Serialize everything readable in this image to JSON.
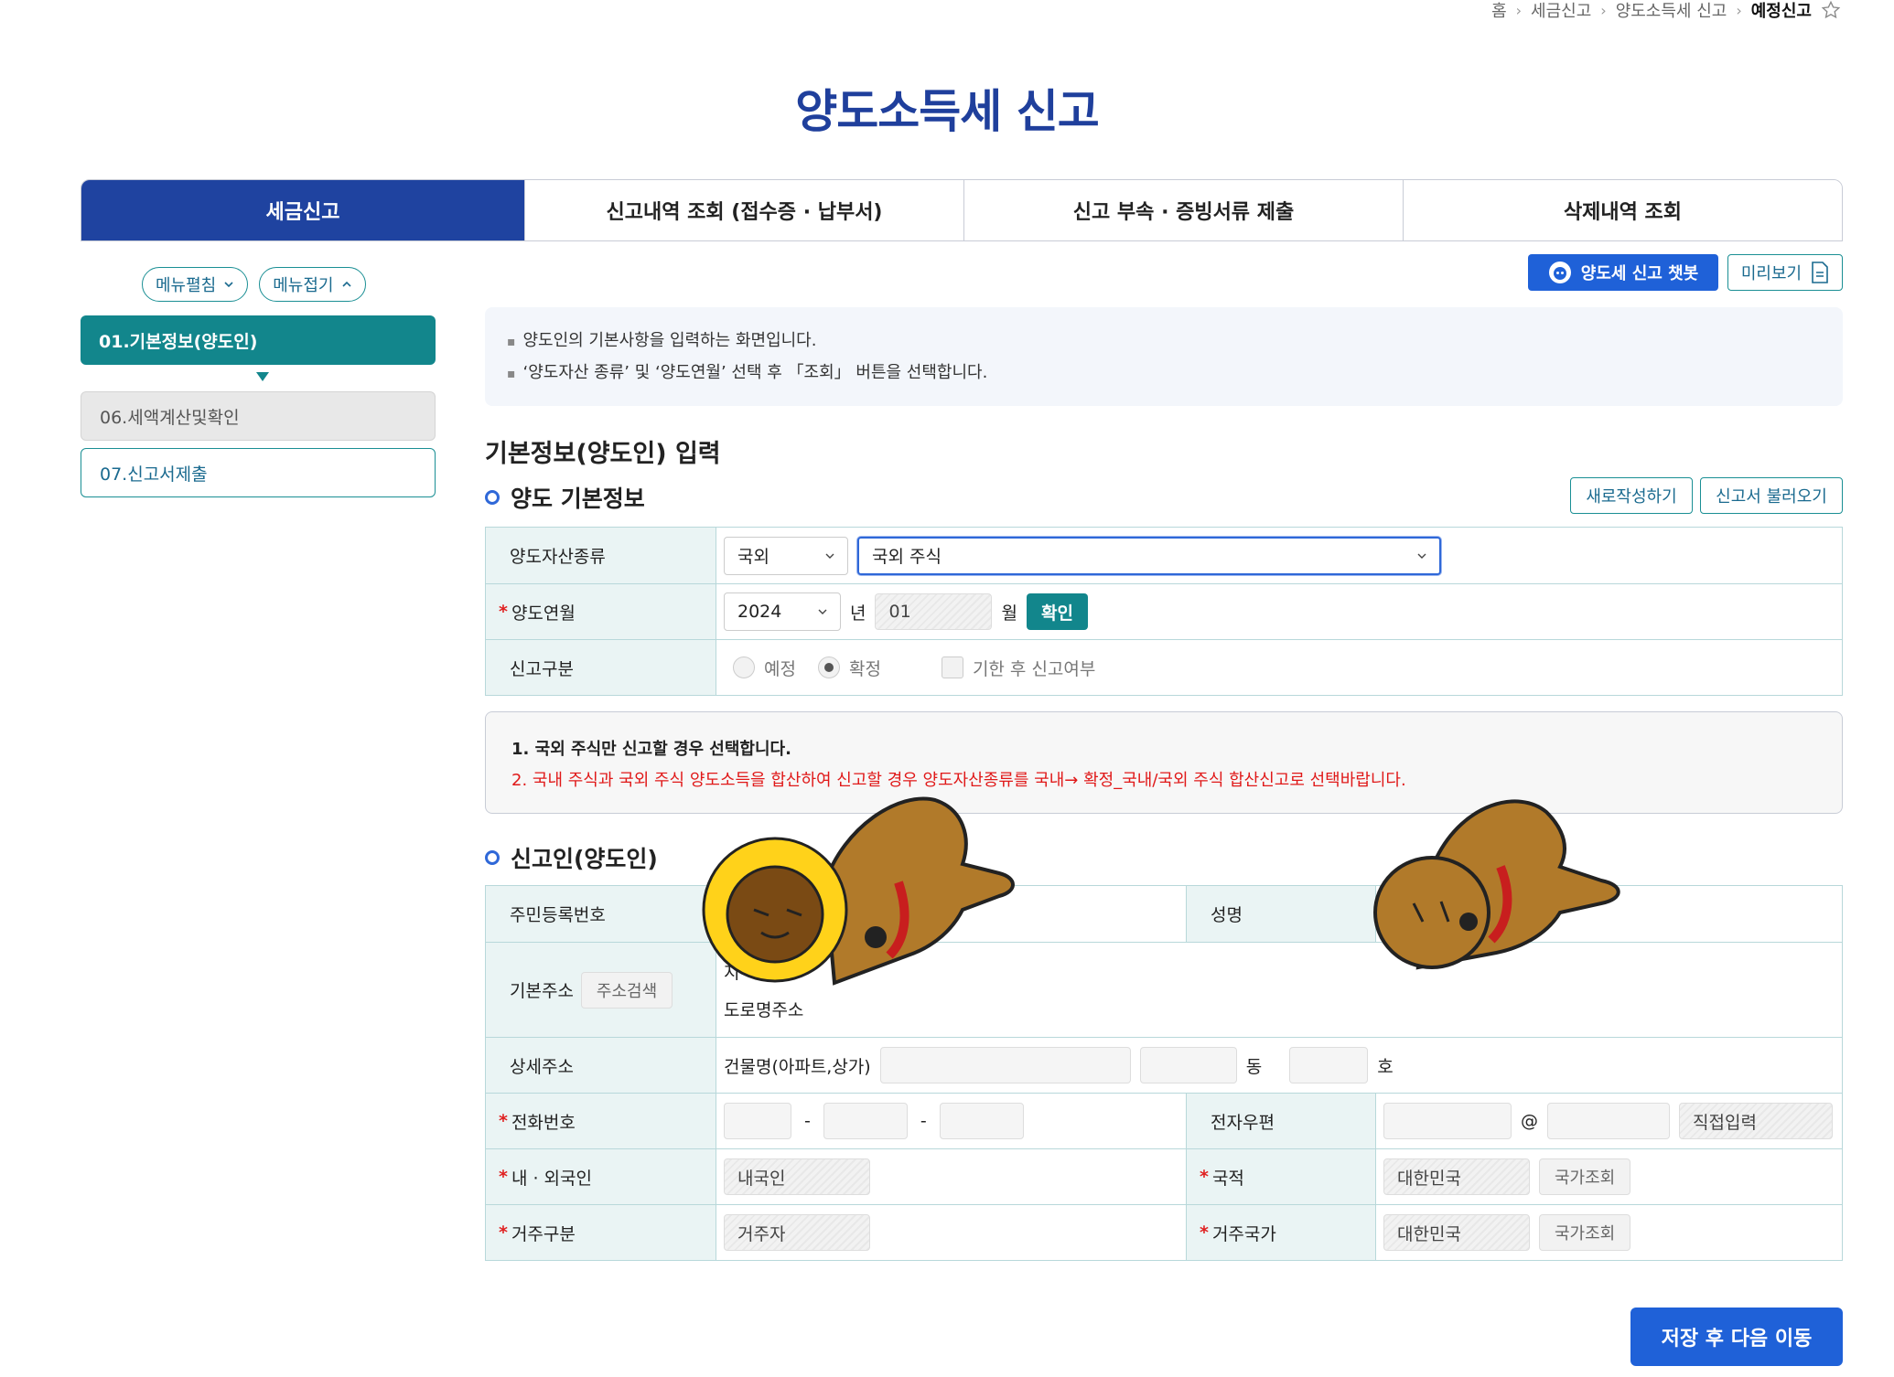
{
  "breadcrumb": {
    "home": "홈",
    "b1": "세금신고",
    "b2": "양도소득세 신고",
    "current": "예정신고"
  },
  "page_title": "양도소득세 신고",
  "tabs": [
    "세금신고",
    "신고내역 조회 (접수증 · 납부서)",
    "신고 부속 · 증빙서류 제출",
    "삭제내역 조회"
  ],
  "sidebar": {
    "expand_label": "메뉴펼침",
    "collapse_label": "메뉴접기",
    "items": [
      "01.기본정보(양도인)",
      "06.세액계산및확인",
      "07.신고서제출"
    ]
  },
  "actions": {
    "chatbot_label": "양도세 신고 챗봇",
    "preview_label": "미리보기"
  },
  "notice": [
    "양도인의 기본사항을 입력하는 화면입니다.",
    "‘양도자산 종류’ 및 ‘양도연월’ 선택 후 「조회」 버튼을 선택합니다."
  ],
  "section_title": "기본정보(양도인) 입력",
  "basic": {
    "title": "양도 기본정보",
    "new_btn": "새로작성하기",
    "load_btn": "신고서 불러오기",
    "asset_type_label": "양도자산종류",
    "asset_region": "국외",
    "asset_kind": "국외 주식",
    "period_label": "양도연월",
    "year": "2024",
    "year_unit": "년",
    "month": "01",
    "month_unit": "월",
    "confirm_btn": "확인",
    "report_type_label": "신고구분",
    "opt_prelim": "예정",
    "opt_final": "확정",
    "opt_late": "기한 후 신고여부"
  },
  "warnings": [
    "1. 국외 주식만 신고할 경우 선택합니다.",
    "2. 국내 주식과 국외 주식 양도소득을 합산하여 신고할 경우 양도자산종류를 국내→ 확정_국내/국외 주식 합산신고로 선택바랍니다."
  ],
  "filer": {
    "title": "신고인(양도인)",
    "rrn_label": "주민등록번호",
    "name_label": "성명",
    "address_label": "기본주소",
    "address_search_btn": "주소검색",
    "address_line1_prefix": "지",
    "address_line2": "도로명주소",
    "detail_label": "상세주소",
    "building_label": "건물명(아파트,상가)",
    "dong_unit": "동",
    "ho_unit": "호",
    "phone_label": "전화번호",
    "phone_sep": "-",
    "email_label": "전자우편",
    "email_at": "@",
    "email_direct": "직접입력",
    "citizen_label": "내 · 외국인",
    "citizen_value": "내국인",
    "nationality_label": "국적",
    "nationality_value": "대한민국",
    "country_lookup_btn": "국가조회",
    "residency_label": "거주구분",
    "residency_value": "거주자",
    "residence_country_label": "거주국가",
    "residence_country_value": "대한민국"
  },
  "save_btn": "저장 후 다음 이동",
  "colors": {
    "primary": "#1f43a0",
    "teal": "#12868c",
    "blue_btn": "#1f61d8",
    "warn": "#e01818"
  }
}
